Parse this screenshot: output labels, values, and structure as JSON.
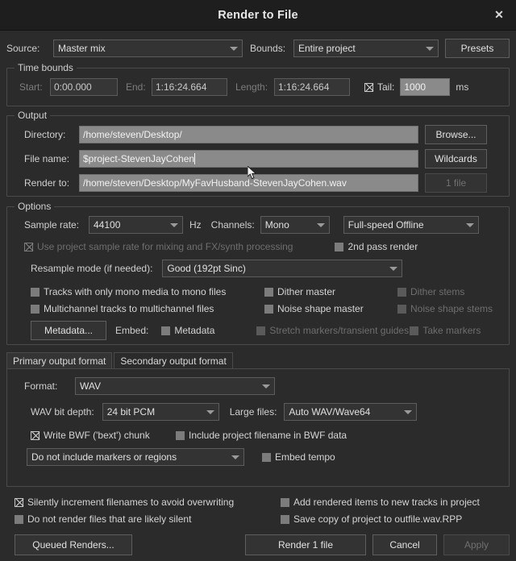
{
  "window": {
    "title": "Render to File",
    "close_icon": "close-icon"
  },
  "top": {
    "source_label": "Source:",
    "source_value": "Master mix",
    "bounds_label": "Bounds:",
    "bounds_value": "Entire project",
    "presets_label": "Presets"
  },
  "time_bounds": {
    "legend": "Time bounds",
    "start_label": "Start:",
    "start_value": "0:00.000",
    "end_label": "End:",
    "end_value": "1:16:24.664",
    "length_label": "Length:",
    "length_value": "1:16:24.664",
    "tail_label": "Tail:",
    "tail_checked": true,
    "tail_value": "1000",
    "tail_units": "ms"
  },
  "output": {
    "legend": "Output",
    "directory_label": "Directory:",
    "directory_value": "/home/steven/Desktop/",
    "browse_label": "Browse...",
    "filename_label": "File name:",
    "filename_value": "$project-StevenJayCohen",
    "wildcards_label": "Wildcards",
    "renderto_label": "Render to:",
    "renderto_value": "/home/steven/Desktop/MyFavHusband-StevenJayCohen.wav",
    "filecount_label": "1 file"
  },
  "options": {
    "legend": "Options",
    "samplerate_label": "Sample rate:",
    "samplerate_value": "44100",
    "hz_label": "Hz",
    "channels_label": "Channels:",
    "channels_value": "Mono",
    "speed_value": "Full-speed Offline",
    "use_project_rate_label": "Use project sample rate for mixing and FX/synth processing",
    "use_project_rate_checked": true,
    "second_pass_label": "2nd pass render",
    "second_pass_checked": false,
    "resample_label": "Resample mode (if needed):",
    "resample_value": "Good (192pt Sinc)",
    "mono_tracks_label": "Tracks with only mono media to mono files",
    "mono_tracks_checked": false,
    "dither_master_label": "Dither master",
    "dither_master_checked": false,
    "dither_stems_label": "Dither stems",
    "dither_stems_checked": false,
    "multichannel_label": "Multichannel tracks to multichannel files",
    "multichannel_checked": false,
    "noise_shape_master_label": "Noise shape master",
    "noise_shape_master_checked": false,
    "noise_shape_stems_label": "Noise shape stems",
    "noise_shape_stems_checked": false,
    "metadata_button_label": "Metadata...",
    "embed_label": "Embed:",
    "embed_metadata_label": "Metadata",
    "embed_metadata_checked": false,
    "stretch_markers_label": "Stretch markers/transient guides",
    "stretch_markers_checked": false,
    "take_markers_label": "Take markers",
    "take_markers_checked": false
  },
  "format_tabs": {
    "primary_label": "Primary output format",
    "secondary_label": "Secondary output format",
    "active": "primary"
  },
  "format": {
    "format_label": "Format:",
    "format_value": "WAV",
    "bitdepth_label": "WAV bit depth:",
    "bitdepth_value": "24 bit PCM",
    "largefiles_label": "Large files:",
    "largefiles_value": "Auto WAV/Wave64",
    "write_bwf_label": "Write BWF ('bext') chunk",
    "write_bwf_checked": true,
    "include_project_filename_label": "Include project filename in BWF data",
    "include_project_filename_checked": false,
    "markers_value": "Do not include markers or regions",
    "embed_tempo_label": "Embed tempo",
    "embed_tempo_checked": false
  },
  "bottom": {
    "silently_increment_label": "Silently increment filenames to avoid overwriting",
    "silently_increment_checked": true,
    "add_rendered_items_label": "Add rendered items to new tracks in project",
    "add_rendered_items_checked": false,
    "do_not_render_silent_label": "Do not render files that are likely silent",
    "do_not_render_silent_checked": false,
    "save_copy_label": "Save copy of project to outfile.wav.RPP",
    "save_copy_checked": false,
    "queued_renders_label": "Queued Renders...",
    "render_label": "Render 1 file",
    "cancel_label": "Cancel",
    "apply_label": "Apply"
  },
  "colors": {
    "window_bg": "#2b2b2b",
    "titlebar_bg": "#1e1e1e",
    "field_bg": "#8a8a8a",
    "border": "#4a4a4a"
  }
}
